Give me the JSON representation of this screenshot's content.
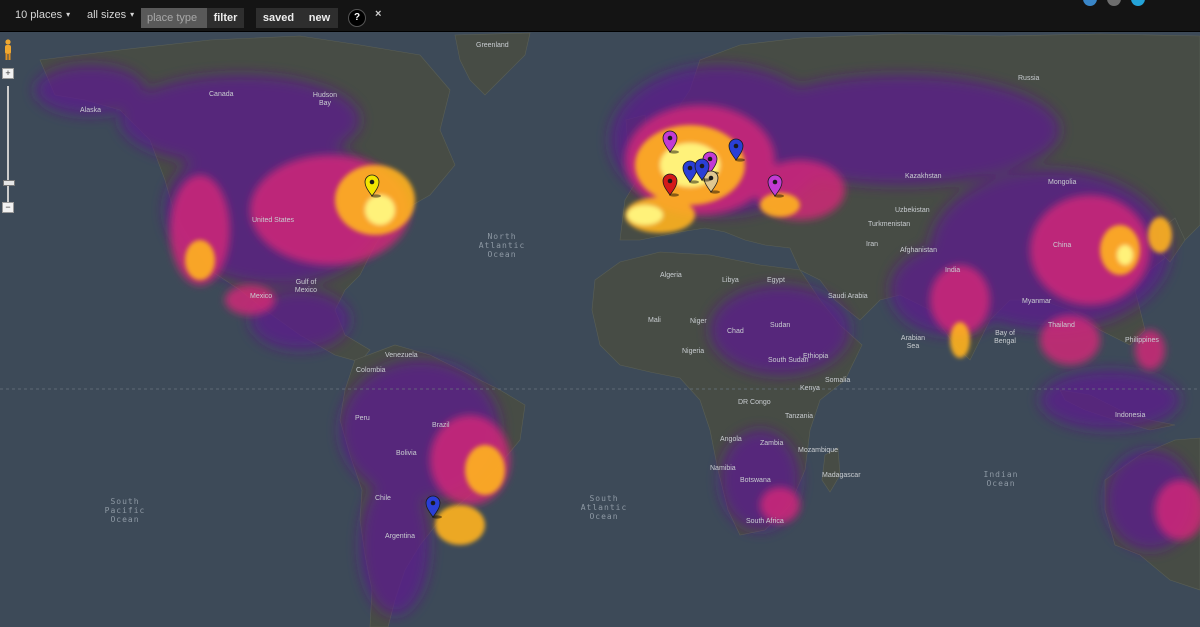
{
  "toolbar": {
    "places_label": "10 places",
    "sizes_label": "all sizes",
    "caret": "▾",
    "place_placeholder": "place type",
    "filter_label": "filter",
    "saved_label": "saved",
    "new_label": "new",
    "help_label": "?",
    "close_label": "×"
  },
  "zoom": {
    "plus": "+",
    "minus": "−"
  },
  "colors": {
    "ocean": "#3d4a58",
    "land": "#484c44",
    "heat_low": "#6a1b9a",
    "heat_mid": "#ff2d78",
    "heat_high": "#ffd21f",
    "heat_max": "#fffb7a"
  },
  "map_labels": {
    "greenland": "Greenland",
    "canada": "Canada",
    "alaska": "Alaska",
    "united_states": "United States",
    "mexico": "Mexico",
    "venezuela": "Venezuela",
    "colombia": "Colombia",
    "peru": "Peru",
    "brazil": "Brazil",
    "bolivia": "Bolivia",
    "argentina": "Argentina",
    "chile": "Chile",
    "russia": "Russia",
    "kazakhstan": "Kazakhstan",
    "mongolia": "Mongolia",
    "china": "China",
    "india": "India",
    "iran": "Iran",
    "afghanistan": "Afghanistan",
    "saudi_arabia": "Saudi Arabia",
    "egypt": "Egypt",
    "libya": "Libya",
    "algeria": "Algeria",
    "mali": "Mali",
    "niger": "Niger",
    "chad": "Chad",
    "sudan": "Sudan",
    "ethiopia": "Ethiopia",
    "nigeria": "Nigeria",
    "dr_congo": "DR Congo",
    "angola": "Angola",
    "zambia": "Zambia",
    "namibia": "Namibia",
    "botswana": "Botswana",
    "south_africa": "South Africa",
    "mozambique": "Mozambique",
    "madagascar": "Madagascar",
    "kenya": "Kenya",
    "tanzania": "Tanzania",
    "somalia": "Somalia",
    "turkmenistan": "Turkmenistan",
    "uzbekistan": "Uzbekistan",
    "myanmar": "Myanmar",
    "thailand": "Thailand",
    "philippines": "Philippines",
    "indonesia": "Indonesia",
    "south_sudan": "South Sudan",
    "north_atlantic_ocean": [
      "North",
      "Atlantic",
      "Ocean"
    ],
    "south_pacific_ocean": [
      "South",
      "Pacific",
      "Ocean"
    ],
    "south_atlantic_ocean": [
      "South",
      "Atlantic",
      "Ocean"
    ],
    "indian_ocean": [
      "Indian",
      "Ocean"
    ],
    "arabian_sea": [
      "Arabian",
      "Sea"
    ],
    "bay_of_bengal": [
      "Bay of",
      "Bengal"
    ],
    "gulf_of_mexico": [
      "Gulf of",
      "Mexico"
    ],
    "hudson_bay": [
      "Hudson",
      "Bay"
    ]
  },
  "markers": [
    {
      "name": "marker-new-york",
      "color": "#f2e400"
    },
    {
      "name": "marker-paris-area",
      "color": "#c23bd4"
    },
    {
      "name": "marker-spain",
      "color": "#d41a1a"
    },
    {
      "name": "marker-france-blue",
      "color": "#2a3fd6"
    },
    {
      "name": "marker-switzerland",
      "color": "#c23bd4"
    },
    {
      "name": "marker-italy",
      "color": "#e0c890"
    },
    {
      "name": "marker-alps-blue",
      "color": "#2a3fd6"
    },
    {
      "name": "marker-czech",
      "color": "#2a3fd6"
    },
    {
      "name": "marker-istanbul",
      "color": "#c23bd4"
    },
    {
      "name": "marker-buenos-aires",
      "color": "#2a3fd6"
    }
  ]
}
